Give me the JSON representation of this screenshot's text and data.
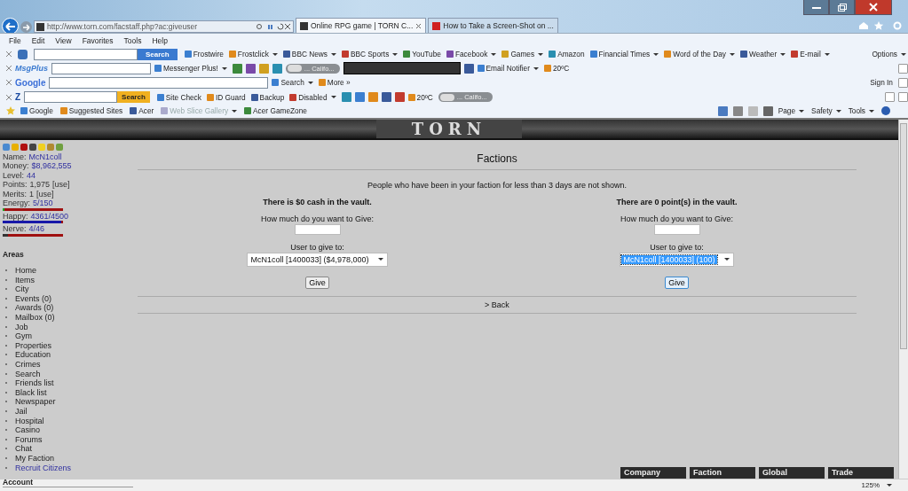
{
  "browser": {
    "address": "http://www.torn.com/facstaff.php?ac:giveuser",
    "tabs": [
      {
        "title": "Online RPG game | TORN C...",
        "selected": true
      },
      {
        "title": "How to Take a Screen-Shot on ...",
        "selected": false
      }
    ],
    "menu": [
      "File",
      "Edit",
      "View",
      "Favorites",
      "Tools",
      "Help"
    ],
    "toolbars": [
      {
        "search_button": "Search",
        "items": [
          {
            "kind": "link",
            "label": "Frostwire",
            "menu": false
          },
          {
            "kind": "link",
            "label": "Frostclick",
            "menu": true
          },
          {
            "kind": "link",
            "label": "BBC News",
            "menu": true
          },
          {
            "kind": "link",
            "label": "BBC Sports",
            "menu": true
          },
          {
            "kind": "link",
            "label": "YouTube",
            "menu": false
          },
          {
            "kind": "link",
            "label": "Facebook",
            "menu": true
          },
          {
            "kind": "link",
            "label": "Games",
            "menu": true
          },
          {
            "kind": "link",
            "label": "Amazon",
            "menu": false
          },
          {
            "kind": "link",
            "label": "Financial Times",
            "menu": true
          },
          {
            "kind": "link",
            "label": "Word of the Day",
            "menu": true
          },
          {
            "kind": "link",
            "label": "Weather",
            "menu": true
          },
          {
            "kind": "link",
            "label": "E-mail",
            "menu": true
          }
        ],
        "right": [
          {
            "kind": "link",
            "label": "Options",
            "menu": true
          }
        ]
      },
      {
        "logo": "MsgPlus",
        "items": [
          {
            "kind": "link",
            "label": "Messenger Plus!",
            "menu": true
          },
          {
            "kind": "icon"
          },
          {
            "kind": "icon"
          },
          {
            "kind": "icon"
          },
          {
            "kind": "icon"
          },
          {
            "kind": "player",
            "label": "... Califo..."
          },
          {
            "kind": "display"
          },
          {
            "kind": "icon"
          },
          {
            "kind": "link",
            "label": "Email Notifier",
            "menu": true
          },
          {
            "kind": "link",
            "label": "20ºC",
            "menu": false
          }
        ],
        "right": [
          {
            "kind": "icon"
          }
        ]
      },
      {
        "logo": "Google",
        "items": [
          {
            "kind": "link",
            "label": "Search",
            "menu": true
          },
          {
            "kind": "link",
            "label": "More »",
            "menu": false
          }
        ],
        "right": [
          {
            "kind": "link",
            "label": "Sign In",
            "menu": false
          },
          {
            "kind": "icon"
          }
        ]
      },
      {
        "logo": "Z",
        "search_button": "Search",
        "items": [
          {
            "kind": "link",
            "label": "Site Check",
            "menu": false
          },
          {
            "kind": "link",
            "label": "ID Guard",
            "menu": false
          },
          {
            "kind": "link",
            "label": "Backup",
            "menu": false
          },
          {
            "kind": "link",
            "label": "Disabled",
            "menu": true
          },
          {
            "kind": "icon"
          },
          {
            "kind": "icon"
          },
          {
            "kind": "icon"
          },
          {
            "kind": "icon"
          },
          {
            "kind": "icon"
          },
          {
            "kind": "link",
            "label": "20ºC",
            "menu": false
          },
          {
            "kind": "player",
            "label": "... Califo..."
          }
        ],
        "right": [
          {
            "kind": "icon"
          },
          {
            "kind": "icon"
          }
        ]
      }
    ],
    "favorites": [
      {
        "label": "Google",
        "disabled": false,
        "menu": false
      },
      {
        "label": "Suggested Sites",
        "disabled": false,
        "menu": false
      },
      {
        "label": "Acer",
        "disabled": false,
        "menu": false
      },
      {
        "label": "Web Slice Gallery",
        "disabled": true,
        "menu": true
      },
      {
        "label": "Acer GameZone",
        "disabled": false,
        "menu": false
      }
    ],
    "command_bar": [
      {
        "label": "Page",
        "menu": true
      },
      {
        "label": "Safety",
        "menu": true
      },
      {
        "label": "Tools",
        "menu": true
      }
    ],
    "status_bar": {
      "zoom": "125%"
    }
  },
  "banner": {
    "logo": "TORN"
  },
  "sidebar": {
    "stats": [
      {
        "label": "Name:",
        "value": "McN1coll"
      },
      {
        "label": "Money:",
        "value": "$8,962,555"
      },
      {
        "label": "Level:",
        "value": "44"
      },
      {
        "label": "Points:",
        "value": "1,975",
        "link": "[use]"
      },
      {
        "label": "Merits:",
        "value": "1",
        "link": "[use]"
      }
    ],
    "meters": [
      {
        "label": "Energy:",
        "value": "5/150",
        "level": 0.03,
        "color": "#22a022"
      },
      {
        "label": "Happy:",
        "value": "4361/4500",
        "level": 0.97,
        "color": "#1818a8"
      },
      {
        "label": "Nerve:",
        "value": "4/46",
        "level": 0.09,
        "color": "#333333"
      }
    ],
    "areas_heading": "Areas",
    "areas": [
      {
        "label": "Home",
        "highlighted": false
      },
      {
        "label": "Items",
        "highlighted": false
      },
      {
        "label": "City",
        "highlighted": false
      },
      {
        "label": "Events (0)",
        "highlighted": false
      },
      {
        "label": "Awards (0)",
        "highlighted": false
      },
      {
        "label": "Mailbox (0)",
        "highlighted": false
      },
      {
        "label": "Job",
        "highlighted": false
      },
      {
        "label": "Gym",
        "highlighted": false
      },
      {
        "label": "Properties",
        "highlighted": false
      },
      {
        "label": "Education",
        "highlighted": false
      },
      {
        "label": "Crimes",
        "highlighted": false
      },
      {
        "label": "Search",
        "highlighted": false
      },
      {
        "label": "Friends list",
        "highlighted": false
      },
      {
        "label": "Black list",
        "highlighted": false
      },
      {
        "label": "Newspaper",
        "highlighted": false
      },
      {
        "label": "Jail",
        "highlighted": false
      },
      {
        "label": "Hospital",
        "highlighted": false
      },
      {
        "label": "Casino",
        "highlighted": false
      },
      {
        "label": "Forums",
        "highlighted": false
      },
      {
        "label": "Chat",
        "highlighted": false
      },
      {
        "label": "My Faction",
        "highlighted": false
      },
      {
        "label": "Recruit Citizens",
        "highlighted": true
      }
    ],
    "account_heading": "Account"
  },
  "main": {
    "title": "Factions",
    "note": "People who have been in your faction for less than 3 days are not shown.",
    "columns": [
      {
        "heading": "There is $0 cash in the vault.",
        "amount_label": "How much do you want to Give:",
        "user_label": "User to give to:",
        "user_value": "McN1coll [1400033] ($4,978,000)",
        "focused": false,
        "button": "Give"
      },
      {
        "heading": "There are 0 point(s) in the vault.",
        "amount_label": "How much do you want to Give:",
        "user_label": "User to give to:",
        "user_value": "McN1coll [1400033] (100)",
        "focused": true,
        "button": "Give"
      }
    ],
    "back": "> Back"
  },
  "chat_tabs": [
    "Company",
    "Faction",
    "Global",
    "Trade"
  ]
}
